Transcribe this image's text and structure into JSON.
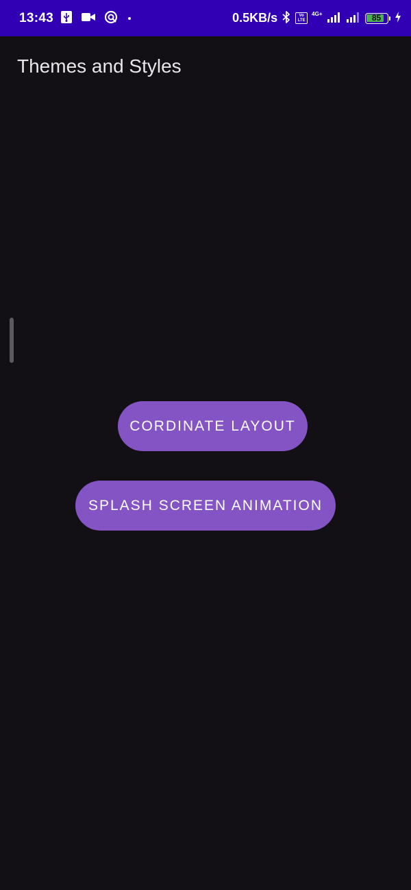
{
  "status_bar": {
    "time": "13:43",
    "left_icons": [
      "usb-icon",
      "video-camera-icon",
      "hotspot-icon",
      "dot-icon"
    ],
    "net_speed": "0.5KB/s",
    "volte_label": "Vo LTE",
    "network_type": "4G+",
    "battery_level": "85",
    "battery_fraction": 0.85,
    "colors": {
      "background": "#3100b4",
      "battery_fill": "#4caf50"
    }
  },
  "app_bar": {
    "title": "Themes and Styles"
  },
  "main": {
    "buttons": [
      {
        "label": "CORDINATE LAYOUT"
      },
      {
        "label": "SPLASH SCREEN ANIMATION"
      }
    ]
  },
  "theme": {
    "background": "#121014",
    "button_color": "#8554c4",
    "title_color": "#e9e6ea"
  }
}
